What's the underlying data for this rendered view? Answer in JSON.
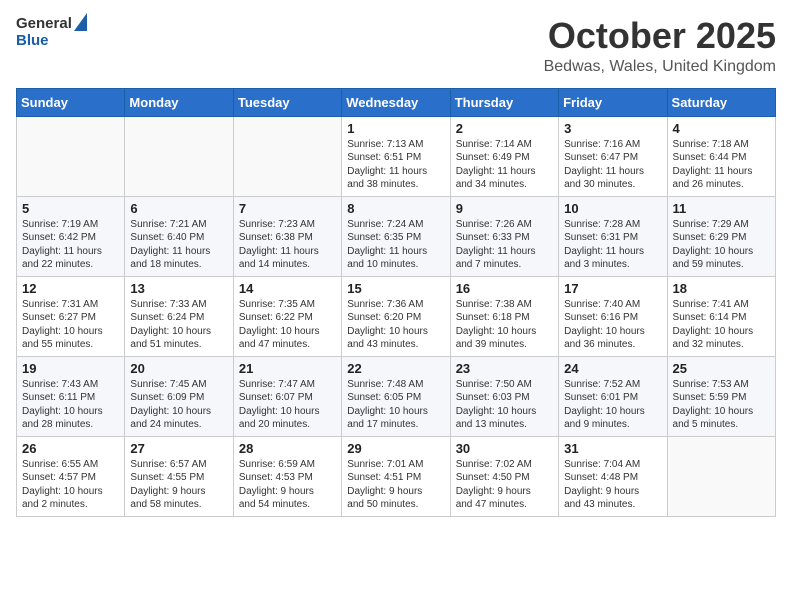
{
  "header": {
    "logo_general": "General",
    "logo_blue": "Blue",
    "title": "October 2025",
    "location": "Bedwas, Wales, United Kingdom"
  },
  "weekdays": [
    "Sunday",
    "Monday",
    "Tuesday",
    "Wednesday",
    "Thursday",
    "Friday",
    "Saturday"
  ],
  "weeks": [
    [
      {
        "day": "",
        "info": ""
      },
      {
        "day": "",
        "info": ""
      },
      {
        "day": "",
        "info": ""
      },
      {
        "day": "1",
        "info": "Sunrise: 7:13 AM\nSunset: 6:51 PM\nDaylight: 11 hours\nand 38 minutes."
      },
      {
        "day": "2",
        "info": "Sunrise: 7:14 AM\nSunset: 6:49 PM\nDaylight: 11 hours\nand 34 minutes."
      },
      {
        "day": "3",
        "info": "Sunrise: 7:16 AM\nSunset: 6:47 PM\nDaylight: 11 hours\nand 30 minutes."
      },
      {
        "day": "4",
        "info": "Sunrise: 7:18 AM\nSunset: 6:44 PM\nDaylight: 11 hours\nand 26 minutes."
      }
    ],
    [
      {
        "day": "5",
        "info": "Sunrise: 7:19 AM\nSunset: 6:42 PM\nDaylight: 11 hours\nand 22 minutes."
      },
      {
        "day": "6",
        "info": "Sunrise: 7:21 AM\nSunset: 6:40 PM\nDaylight: 11 hours\nand 18 minutes."
      },
      {
        "day": "7",
        "info": "Sunrise: 7:23 AM\nSunset: 6:38 PM\nDaylight: 11 hours\nand 14 minutes."
      },
      {
        "day": "8",
        "info": "Sunrise: 7:24 AM\nSunset: 6:35 PM\nDaylight: 11 hours\nand 10 minutes."
      },
      {
        "day": "9",
        "info": "Sunrise: 7:26 AM\nSunset: 6:33 PM\nDaylight: 11 hours\nand 7 minutes."
      },
      {
        "day": "10",
        "info": "Sunrise: 7:28 AM\nSunset: 6:31 PM\nDaylight: 11 hours\nand 3 minutes."
      },
      {
        "day": "11",
        "info": "Sunrise: 7:29 AM\nSunset: 6:29 PM\nDaylight: 10 hours\nand 59 minutes."
      }
    ],
    [
      {
        "day": "12",
        "info": "Sunrise: 7:31 AM\nSunset: 6:27 PM\nDaylight: 10 hours\nand 55 minutes."
      },
      {
        "day": "13",
        "info": "Sunrise: 7:33 AM\nSunset: 6:24 PM\nDaylight: 10 hours\nand 51 minutes."
      },
      {
        "day": "14",
        "info": "Sunrise: 7:35 AM\nSunset: 6:22 PM\nDaylight: 10 hours\nand 47 minutes."
      },
      {
        "day": "15",
        "info": "Sunrise: 7:36 AM\nSunset: 6:20 PM\nDaylight: 10 hours\nand 43 minutes."
      },
      {
        "day": "16",
        "info": "Sunrise: 7:38 AM\nSunset: 6:18 PM\nDaylight: 10 hours\nand 39 minutes."
      },
      {
        "day": "17",
        "info": "Sunrise: 7:40 AM\nSunset: 6:16 PM\nDaylight: 10 hours\nand 36 minutes."
      },
      {
        "day": "18",
        "info": "Sunrise: 7:41 AM\nSunset: 6:14 PM\nDaylight: 10 hours\nand 32 minutes."
      }
    ],
    [
      {
        "day": "19",
        "info": "Sunrise: 7:43 AM\nSunset: 6:11 PM\nDaylight: 10 hours\nand 28 minutes."
      },
      {
        "day": "20",
        "info": "Sunrise: 7:45 AM\nSunset: 6:09 PM\nDaylight: 10 hours\nand 24 minutes."
      },
      {
        "day": "21",
        "info": "Sunrise: 7:47 AM\nSunset: 6:07 PM\nDaylight: 10 hours\nand 20 minutes."
      },
      {
        "day": "22",
        "info": "Sunrise: 7:48 AM\nSunset: 6:05 PM\nDaylight: 10 hours\nand 17 minutes."
      },
      {
        "day": "23",
        "info": "Sunrise: 7:50 AM\nSunset: 6:03 PM\nDaylight: 10 hours\nand 13 minutes."
      },
      {
        "day": "24",
        "info": "Sunrise: 7:52 AM\nSunset: 6:01 PM\nDaylight: 10 hours\nand 9 minutes."
      },
      {
        "day": "25",
        "info": "Sunrise: 7:53 AM\nSunset: 5:59 PM\nDaylight: 10 hours\nand 5 minutes."
      }
    ],
    [
      {
        "day": "26",
        "info": "Sunrise: 6:55 AM\nSunset: 4:57 PM\nDaylight: 10 hours\nand 2 minutes."
      },
      {
        "day": "27",
        "info": "Sunrise: 6:57 AM\nSunset: 4:55 PM\nDaylight: 9 hours\nand 58 minutes."
      },
      {
        "day": "28",
        "info": "Sunrise: 6:59 AM\nSunset: 4:53 PM\nDaylight: 9 hours\nand 54 minutes."
      },
      {
        "day": "29",
        "info": "Sunrise: 7:01 AM\nSunset: 4:51 PM\nDaylight: 9 hours\nand 50 minutes."
      },
      {
        "day": "30",
        "info": "Sunrise: 7:02 AM\nSunset: 4:50 PM\nDaylight: 9 hours\nand 47 minutes."
      },
      {
        "day": "31",
        "info": "Sunrise: 7:04 AM\nSunset: 4:48 PM\nDaylight: 9 hours\nand 43 minutes."
      },
      {
        "day": "",
        "info": ""
      }
    ]
  ]
}
